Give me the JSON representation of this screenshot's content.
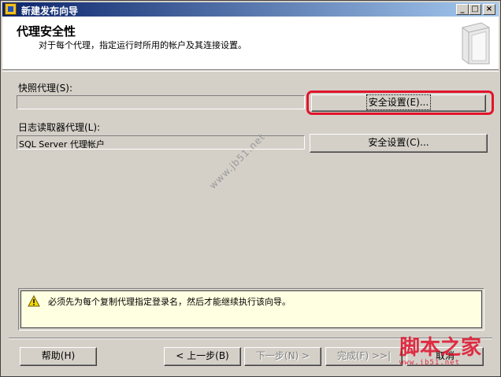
{
  "window": {
    "title": "新建发布向导",
    "min_glyph": "_",
    "max_glyph": "□",
    "close_glyph": "×"
  },
  "header": {
    "title": "代理安全性",
    "subtitle": "对于每个代理，指定运行时所用的帐户及其连接设置。"
  },
  "snapshot_agent": {
    "label": "快照代理(S):",
    "value": "",
    "button_label": "安全设置(E)..."
  },
  "logreader_agent": {
    "label": "日志读取器代理(L):",
    "value": "SQL Server 代理帐户",
    "button_label": "安全设置(C)..."
  },
  "watermark": "www.jb51.net",
  "message": {
    "text": "必须先为每个复制代理指定登录名，然后才能继续执行该向导。",
    "icon": "warning-icon"
  },
  "footer": {
    "help": "帮助(H)",
    "back": "< 上一步(B)",
    "next": "下一步(N) >",
    "finish": "完成(F) >>|",
    "cancel": "取消"
  },
  "corner_logo": {
    "text": "脚本之家",
    "url": "www.jb51.net"
  },
  "colors": {
    "dialog_bg": "#d4d0c8",
    "title_bar": "#0a246a",
    "highlight": "#e0142c",
    "message_bg": "#ffffe1"
  }
}
